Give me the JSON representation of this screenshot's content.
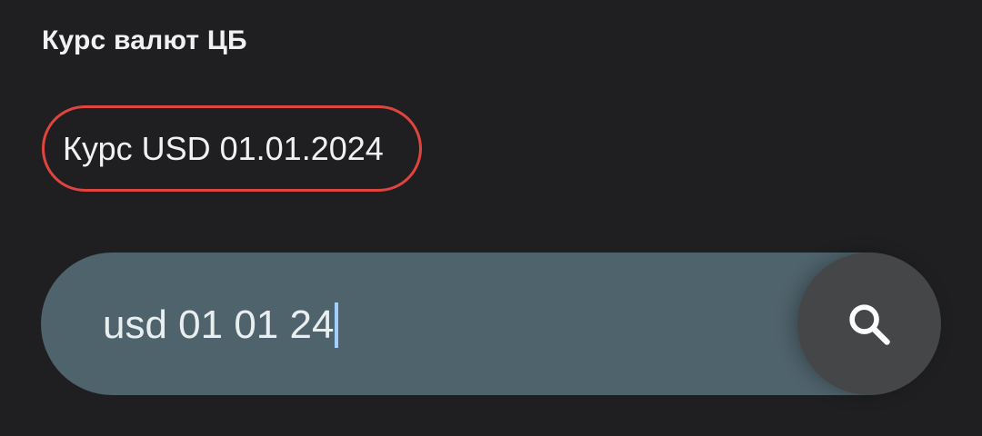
{
  "header": {
    "title": "Курс валют ЦБ"
  },
  "suggestion": {
    "label": "Курс USD 01.01.2024",
    "highlight_color": "#e0443e"
  },
  "search": {
    "value": "usd 01 01 24",
    "button_icon": "search-icon"
  }
}
